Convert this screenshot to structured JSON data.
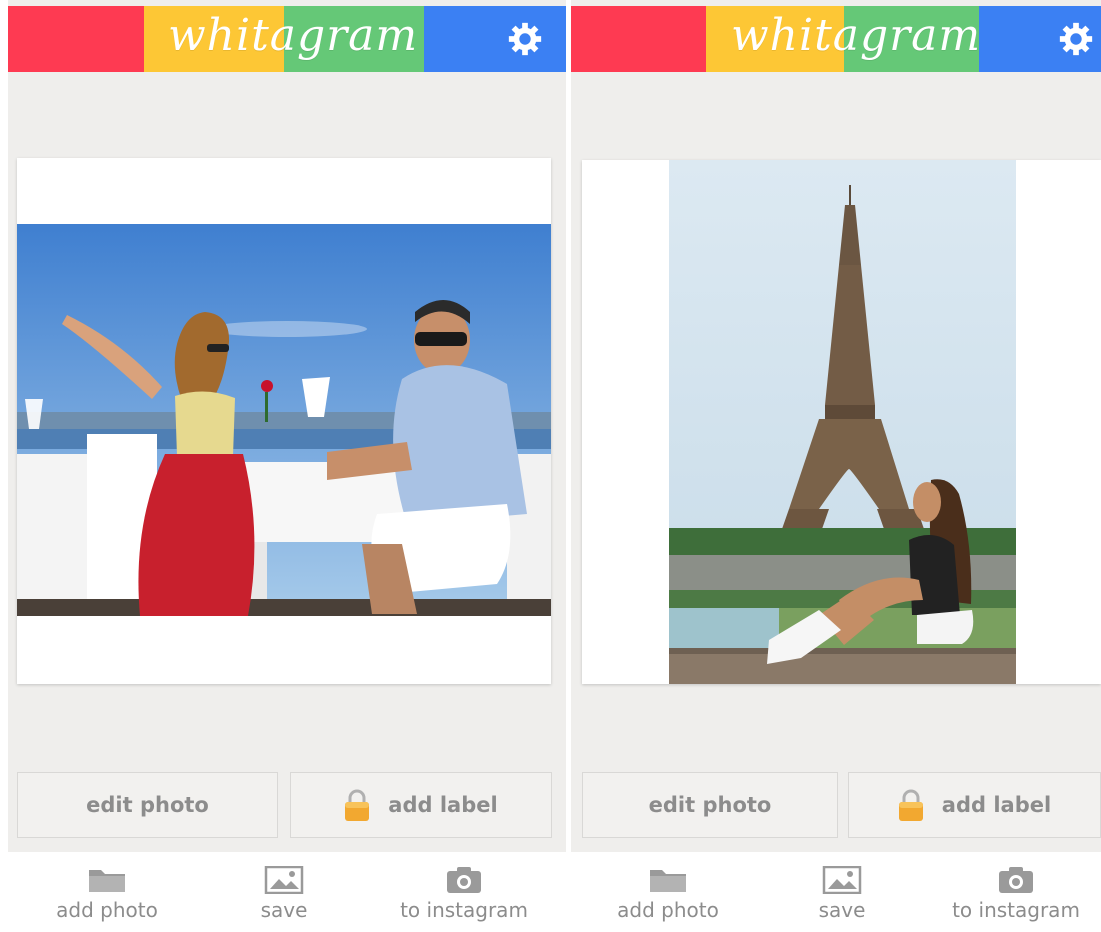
{
  "app": {
    "logo_text": "whitagram",
    "colors": {
      "red": "#fe3a52",
      "yellow": "#fdc735",
      "green": "#65c877",
      "blue": "#3b80f3",
      "background": "#efeeec",
      "button_text": "#8c8c8c"
    }
  },
  "screens": [
    {
      "header": {
        "logo": "whitagram",
        "settings_icon": "gear-icon"
      },
      "photo": {
        "subject": "couple at table by the sea"
      },
      "buttons": {
        "edit": "edit photo",
        "label": "add label",
        "label_icon": "lock-icon"
      },
      "bottom_bar": [
        {
          "label": "add photo",
          "icon": "folder-icon"
        },
        {
          "label": "save",
          "icon": "image-icon"
        },
        {
          "label": "to instagram",
          "icon": "camera-icon"
        }
      ]
    },
    {
      "header": {
        "logo": "whitagram",
        "settings_icon": "gear-icon"
      },
      "photo": {
        "subject": "woman sitting in front of eiffel tower"
      },
      "buttons": {
        "edit": "edit photo",
        "label": "add label",
        "label_icon": "lock-icon"
      },
      "bottom_bar": [
        {
          "label": "add photo",
          "icon": "folder-icon"
        },
        {
          "label": "save",
          "icon": "image-icon"
        },
        {
          "label": "to instagram",
          "icon": "camera-icon"
        }
      ]
    }
  ]
}
